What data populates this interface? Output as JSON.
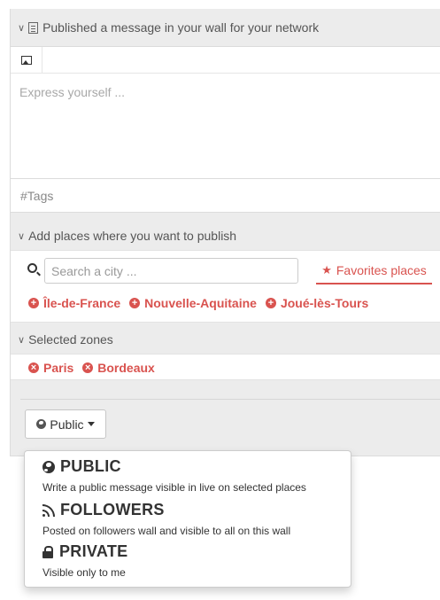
{
  "publish": {
    "header": "Published a message in your wall for your network",
    "editor_placeholder": "Express yourself ...",
    "tags_placeholder": "#Tags"
  },
  "places": {
    "header": "Add places where you want to publish",
    "search_placeholder": "Search a city ...",
    "favorites_tab": "Favorites places",
    "suggestions": [
      "Île-de-France",
      "Nouvelle-Aquitaine",
      "Joué-lès-Tours"
    ]
  },
  "zones": {
    "header": "Selected zones",
    "items": [
      "Paris",
      "Bordeaux"
    ]
  },
  "visibility": {
    "button_label": "Public",
    "options": [
      {
        "title": "PUBLIC",
        "description": "Write a public message visible in live on selected places",
        "icon": "globe-icon"
      },
      {
        "title": "FOLLOWERS",
        "description": "Posted on followers wall and visible to all on this wall",
        "icon": "rss-icon"
      },
      {
        "title": "PRIVATE",
        "description": "Visible only to me",
        "icon": "lock-icon"
      }
    ]
  },
  "colors": {
    "accent": "#d9534f",
    "panel_background": "#ececec"
  }
}
